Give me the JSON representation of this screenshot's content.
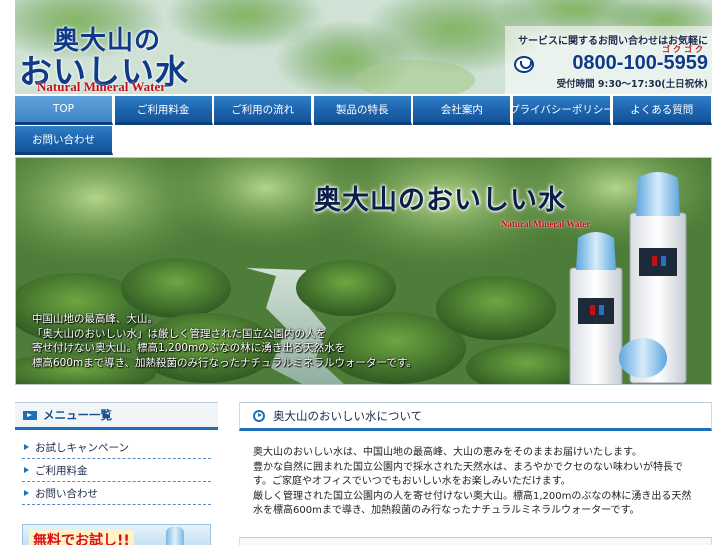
{
  "header": {
    "logo": {
      "line1": "奥大山の",
      "line2": "おいしい水",
      "subtitle": "Natural Mineral Water"
    },
    "contact": {
      "note": "サービスに関するお問い合わせはお気軽に",
      "phone_ruby": "ゴクゴク",
      "phone": "0800-100-5959",
      "hours": "受付時間 9:30～17:30(土日祝休)"
    }
  },
  "nav": {
    "items": [
      {
        "label": "TOP",
        "active": true
      },
      {
        "label": "ご利用料金",
        "active": false
      },
      {
        "label": "ご利用の流れ",
        "active": false
      },
      {
        "label": "製品の特長",
        "active": false
      },
      {
        "label": "会社案内",
        "active": false
      },
      {
        "label": "プライバシーポリシー",
        "active": false
      },
      {
        "label": "よくある質問",
        "active": false
      },
      {
        "label": "お問い合わせ",
        "active": false
      }
    ]
  },
  "banner": {
    "title": "奥大山のおいしい水",
    "subtitle": "Natural Mineral Water",
    "text_lines": [
      "中国山地の最高峰、大山。",
      "「奥大山のおいしい水」は厳しく管理された国立公園内の人を",
      "寄せ付けない奥大山。標高1,200mのぶなの林に湧き出る天然水を",
      "標高600mまで導き、加熱殺菌のみ行なったナチュラルミネラルウォーターです。"
    ]
  },
  "sidebar": {
    "heading": "メニュー一覧",
    "items": [
      {
        "label": "お試しキャンペーン"
      },
      {
        "label": "ご利用料金"
      },
      {
        "label": "お問い合わせ"
      }
    ],
    "promo_label": "無料でお試し!!"
  },
  "main": {
    "heading": "奥大山のおいしい水について",
    "paragraphs": [
      "奥大山のおいしい水は、中国山地の最高峰、大山の恵みをそのままお届けいたします。",
      "豊かな自然に囲まれた国立公園内で採水された天然水は、まろやかでクセのない味わいが特長です。ご家庭やオフィスでいつでもおいしい水をお楽しみいただけます。",
      "厳しく管理された国立公園内の人を寄せ付けない奥大山。標高1,200mのぶなの林に湧き出る天然水を標高600mまで導き、加熱殺菌のみ行なったナチュラルミネラルウォーターです。"
    ]
  },
  "colors": {
    "nav_blue": "#1c64ad",
    "logo_blue": "#0f3a8a",
    "accent_red": "#c0111b"
  }
}
